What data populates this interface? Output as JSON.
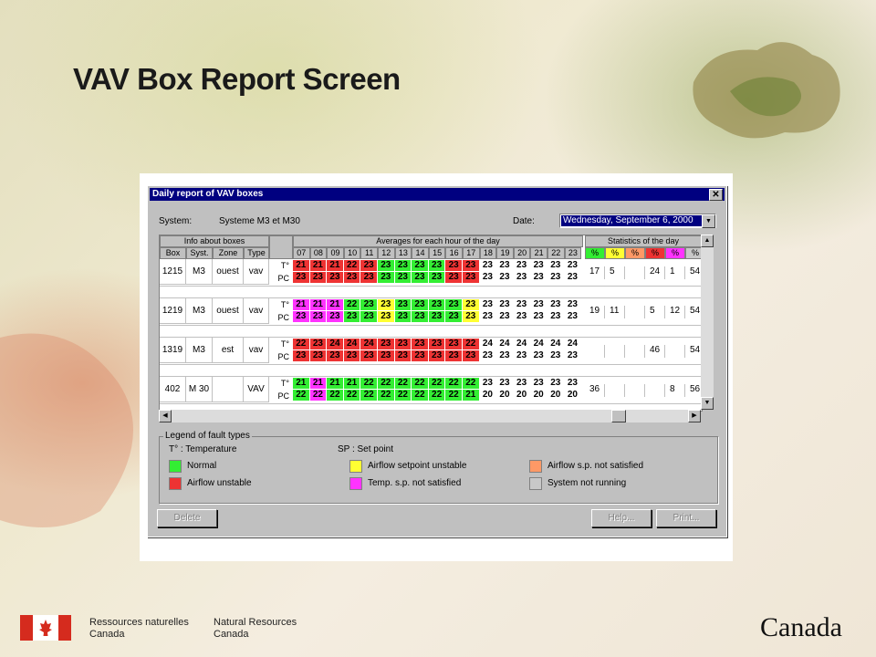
{
  "slide": {
    "title": "VAV Box Report Screen"
  },
  "window": {
    "title": "Daily report of VAV boxes",
    "close": "✕"
  },
  "form": {
    "system_label": "System:",
    "system_value": "Systeme M3 et M30",
    "date_label": "Date:",
    "date_value": "Wednesday, September 6, 2000"
  },
  "grid": {
    "group_info": "Info about boxes",
    "group_avg": "Averages for each hour of the day",
    "group_stats": "Statistics of the day",
    "col_headers": [
      "Box",
      "Syst.",
      "Zone",
      "Type"
    ],
    "hours": [
      "07",
      "08",
      "09",
      "10",
      "11",
      "12",
      "13",
      "14",
      "15",
      "16",
      "17",
      "18",
      "19",
      "20",
      "21",
      "22",
      "23"
    ],
    "stat_headers": [
      "%",
      "%",
      "%",
      "%",
      "%",
      "%"
    ],
    "boxes": [
      {
        "box": "1215",
        "syst": "M3",
        "zone": "ouest",
        "type": "vav",
        "t": [
          "21",
          "21",
          "21",
          "22",
          "23",
          "23",
          "23",
          "23",
          "23",
          "23",
          "23",
          "23",
          "23",
          "23",
          "23",
          "23",
          "23"
        ],
        "pc": [
          "23",
          "23",
          "23",
          "23",
          "23",
          "23",
          "23",
          "23",
          "23",
          "23",
          "23",
          "23",
          "23",
          "23",
          "23",
          "23",
          "23"
        ],
        "stats": [
          "17",
          "5",
          "",
          "24",
          "1",
          "54"
        ]
      },
      {
        "box": "1219",
        "syst": "M3",
        "zone": "ouest",
        "type": "vav",
        "t": [
          "21",
          "21",
          "21",
          "22",
          "23",
          "23",
          "23",
          "23",
          "23",
          "23",
          "23",
          "23",
          "23",
          "23",
          "23",
          "23",
          "23"
        ],
        "pc": [
          "23",
          "23",
          "23",
          "23",
          "23",
          "23",
          "23",
          "23",
          "23",
          "23",
          "23",
          "23",
          "23",
          "23",
          "23",
          "23",
          "23"
        ],
        "stats": [
          "19",
          "11",
          "",
          "5",
          "12",
          "54"
        ]
      },
      {
        "box": "1319",
        "syst": "M3",
        "zone": "est",
        "type": "vav",
        "t": [
          "22",
          "23",
          "24",
          "24",
          "24",
          "23",
          "23",
          "23",
          "23",
          "23",
          "22",
          "24",
          "24",
          "24",
          "24",
          "24",
          "24"
        ],
        "pc": [
          "23",
          "23",
          "23",
          "23",
          "23",
          "23",
          "23",
          "23",
          "23",
          "23",
          "23",
          "23",
          "23",
          "23",
          "23",
          "23",
          "23"
        ],
        "stats": [
          "",
          "",
          "",
          "46",
          "",
          "54"
        ]
      },
      {
        "box": "402",
        "syst": "M 30",
        "zone": "",
        "type": "VAV",
        "t": [
          "21",
          "21",
          "21",
          "21",
          "22",
          "22",
          "22",
          "22",
          "22",
          "22",
          "22",
          "23",
          "23",
          "23",
          "23",
          "23",
          "23"
        ],
        "pc": [
          "22",
          "22",
          "22",
          "22",
          "22",
          "22",
          "22",
          "22",
          "22",
          "22",
          "21",
          "20",
          "20",
          "20",
          "20",
          "20",
          "20"
        ],
        "stats": [
          "36",
          "",
          "",
          "",
          "8",
          "56"
        ]
      }
    ],
    "row_labels": {
      "t": "T°",
      "pc": "PC"
    }
  },
  "colors": {
    "normal": "#33ee33",
    "airflow_unstable": "#ee3333",
    "airflow_sp_unstable": "#ffff33",
    "temp_sp_not_satisfied": "#ff33ff",
    "airflow_sp_not_satisfied": "#ff9966",
    "system_not_running": "#c8c8c8"
  },
  "legend": {
    "title": "Legend of fault types",
    "t_note": "T° : Temperature",
    "sp_note": "SP : Set point",
    "items": [
      "Normal",
      "Airflow unstable",
      "Airflow setpoint unstable",
      "Temp. s.p. not satisfied",
      "Airflow s.p. not satisfied",
      "System not running"
    ]
  },
  "buttons": {
    "delete": "Delete",
    "help": "Help...",
    "print": "Print..."
  },
  "footer": {
    "fr_line1": "Ressources naturelles",
    "fr_line2": "Canada",
    "en_line1": "Natural Resources",
    "en_line2": "Canada",
    "wordmark": "Canada"
  }
}
